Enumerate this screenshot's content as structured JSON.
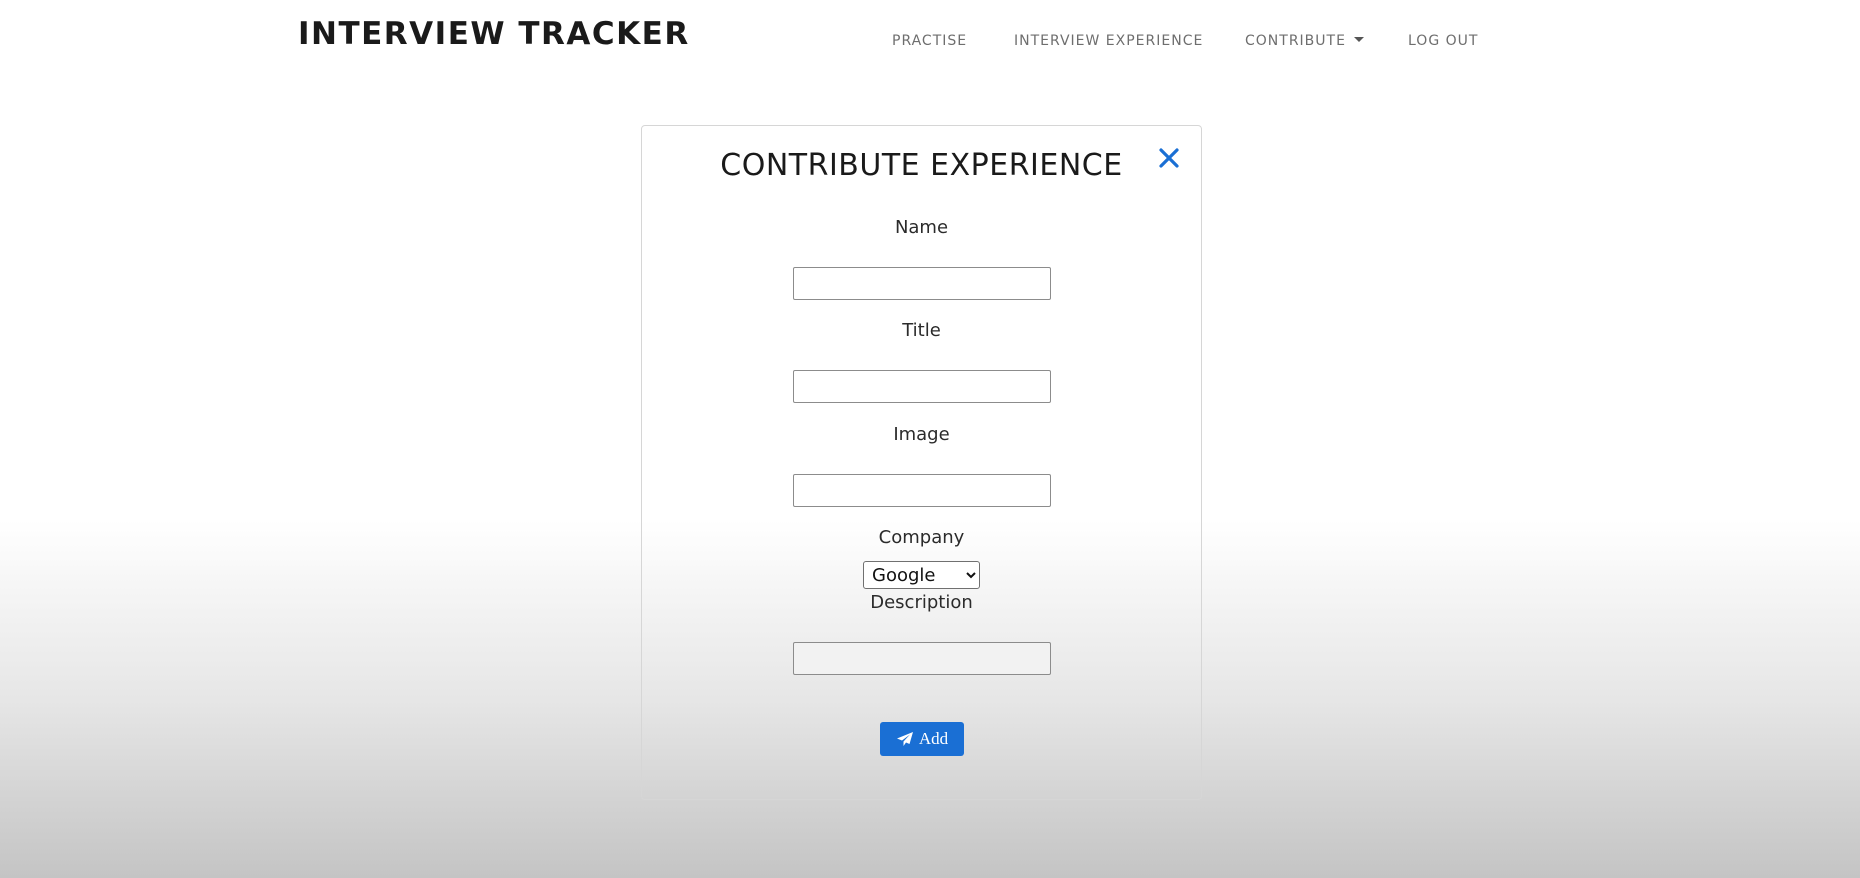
{
  "brand": "INTERVIEW TRACKER",
  "nav": {
    "practise": "PRACTISE",
    "interview_experience": "INTERVIEW EXPERIENCE",
    "contribute": "CONTRIBUTE",
    "logout": "LOG OUT"
  },
  "form": {
    "title": "CONTRIBUTE EXPERIENCE",
    "close_icon": "close-icon",
    "name_label": "Name",
    "name_value": "",
    "title_label": "Title",
    "title_value": "",
    "image_label": "Image",
    "image_value": "",
    "company_label": "Company",
    "company_selected": "Google",
    "description_label": "Description",
    "description_value": "",
    "add_label": "Add",
    "add_icon": "paper-plane-icon"
  },
  "colors": {
    "accent": "#1a6fd4",
    "close": "#1a6fd4",
    "brand_text": "#1a1a1a",
    "nav_text": "#6e6e6e"
  }
}
